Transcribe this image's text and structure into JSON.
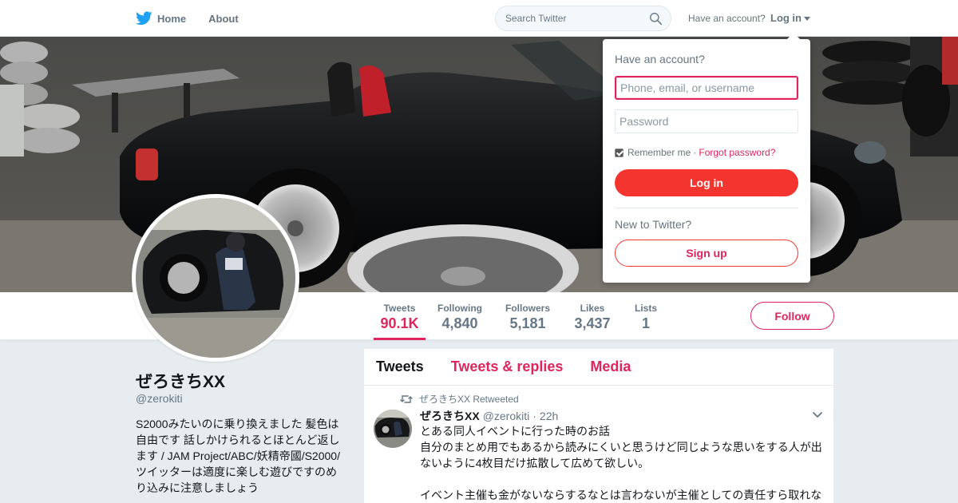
{
  "nav": {
    "home_label": "Home",
    "about_label": "About",
    "search_placeholder": "Search Twitter",
    "have_account": "Have an account?",
    "login_label": "Log in"
  },
  "profile": {
    "name": "ぜろきちXX",
    "handle": "@zerokiti",
    "bio": "S2000みたいのに乗り換えました 髪色は自由です 話しかけられるとほとんど返します / JAM Project/ABC/妖精帝國/S2000/ツイッターは適度に楽しむ遊びですのめり込みに注意しましょう"
  },
  "stats": [
    {
      "label": "Tweets",
      "value": "90.1K",
      "active": true
    },
    {
      "label": "Following",
      "value": "4,840"
    },
    {
      "label": "Followers",
      "value": "5,181"
    },
    {
      "label": "Likes",
      "value": "3,437"
    },
    {
      "label": "Lists",
      "value": "1"
    }
  ],
  "follow_label": "Follow",
  "timeline": {
    "tabs": [
      "Tweets",
      "Tweets & replies",
      "Media"
    ],
    "tweet": {
      "retweeted_by": "ぜろきちXX Retweeted",
      "name": "ぜろきちXX",
      "handle": "@zerokiti",
      "separator": "·",
      "time": "22h",
      "text": "とある同人イベントに行った時のお話\n自分のまとめ用でもあるから読みにくいと思うけど同じような思いをする人が出ないように4枚目だけ拡散して広めて欲しい。\n\nイベント主催も金がないならするなとは言わないが主催としての責任すら取れな"
    }
  },
  "login_dropdown": {
    "title": "Have an account?",
    "username_placeholder": "Phone, email, or username",
    "password_placeholder": "Password",
    "remember_label": "Remember me",
    "separator": "·",
    "forgot_label": "Forgot password?",
    "login_button": "Log in",
    "new_label": "New to Twitter?",
    "signup_button": "Sign up"
  },
  "colors": {
    "accent": "#e0245e",
    "login_button": "#f4352f",
    "twitter_blue": "#1da1f2"
  }
}
